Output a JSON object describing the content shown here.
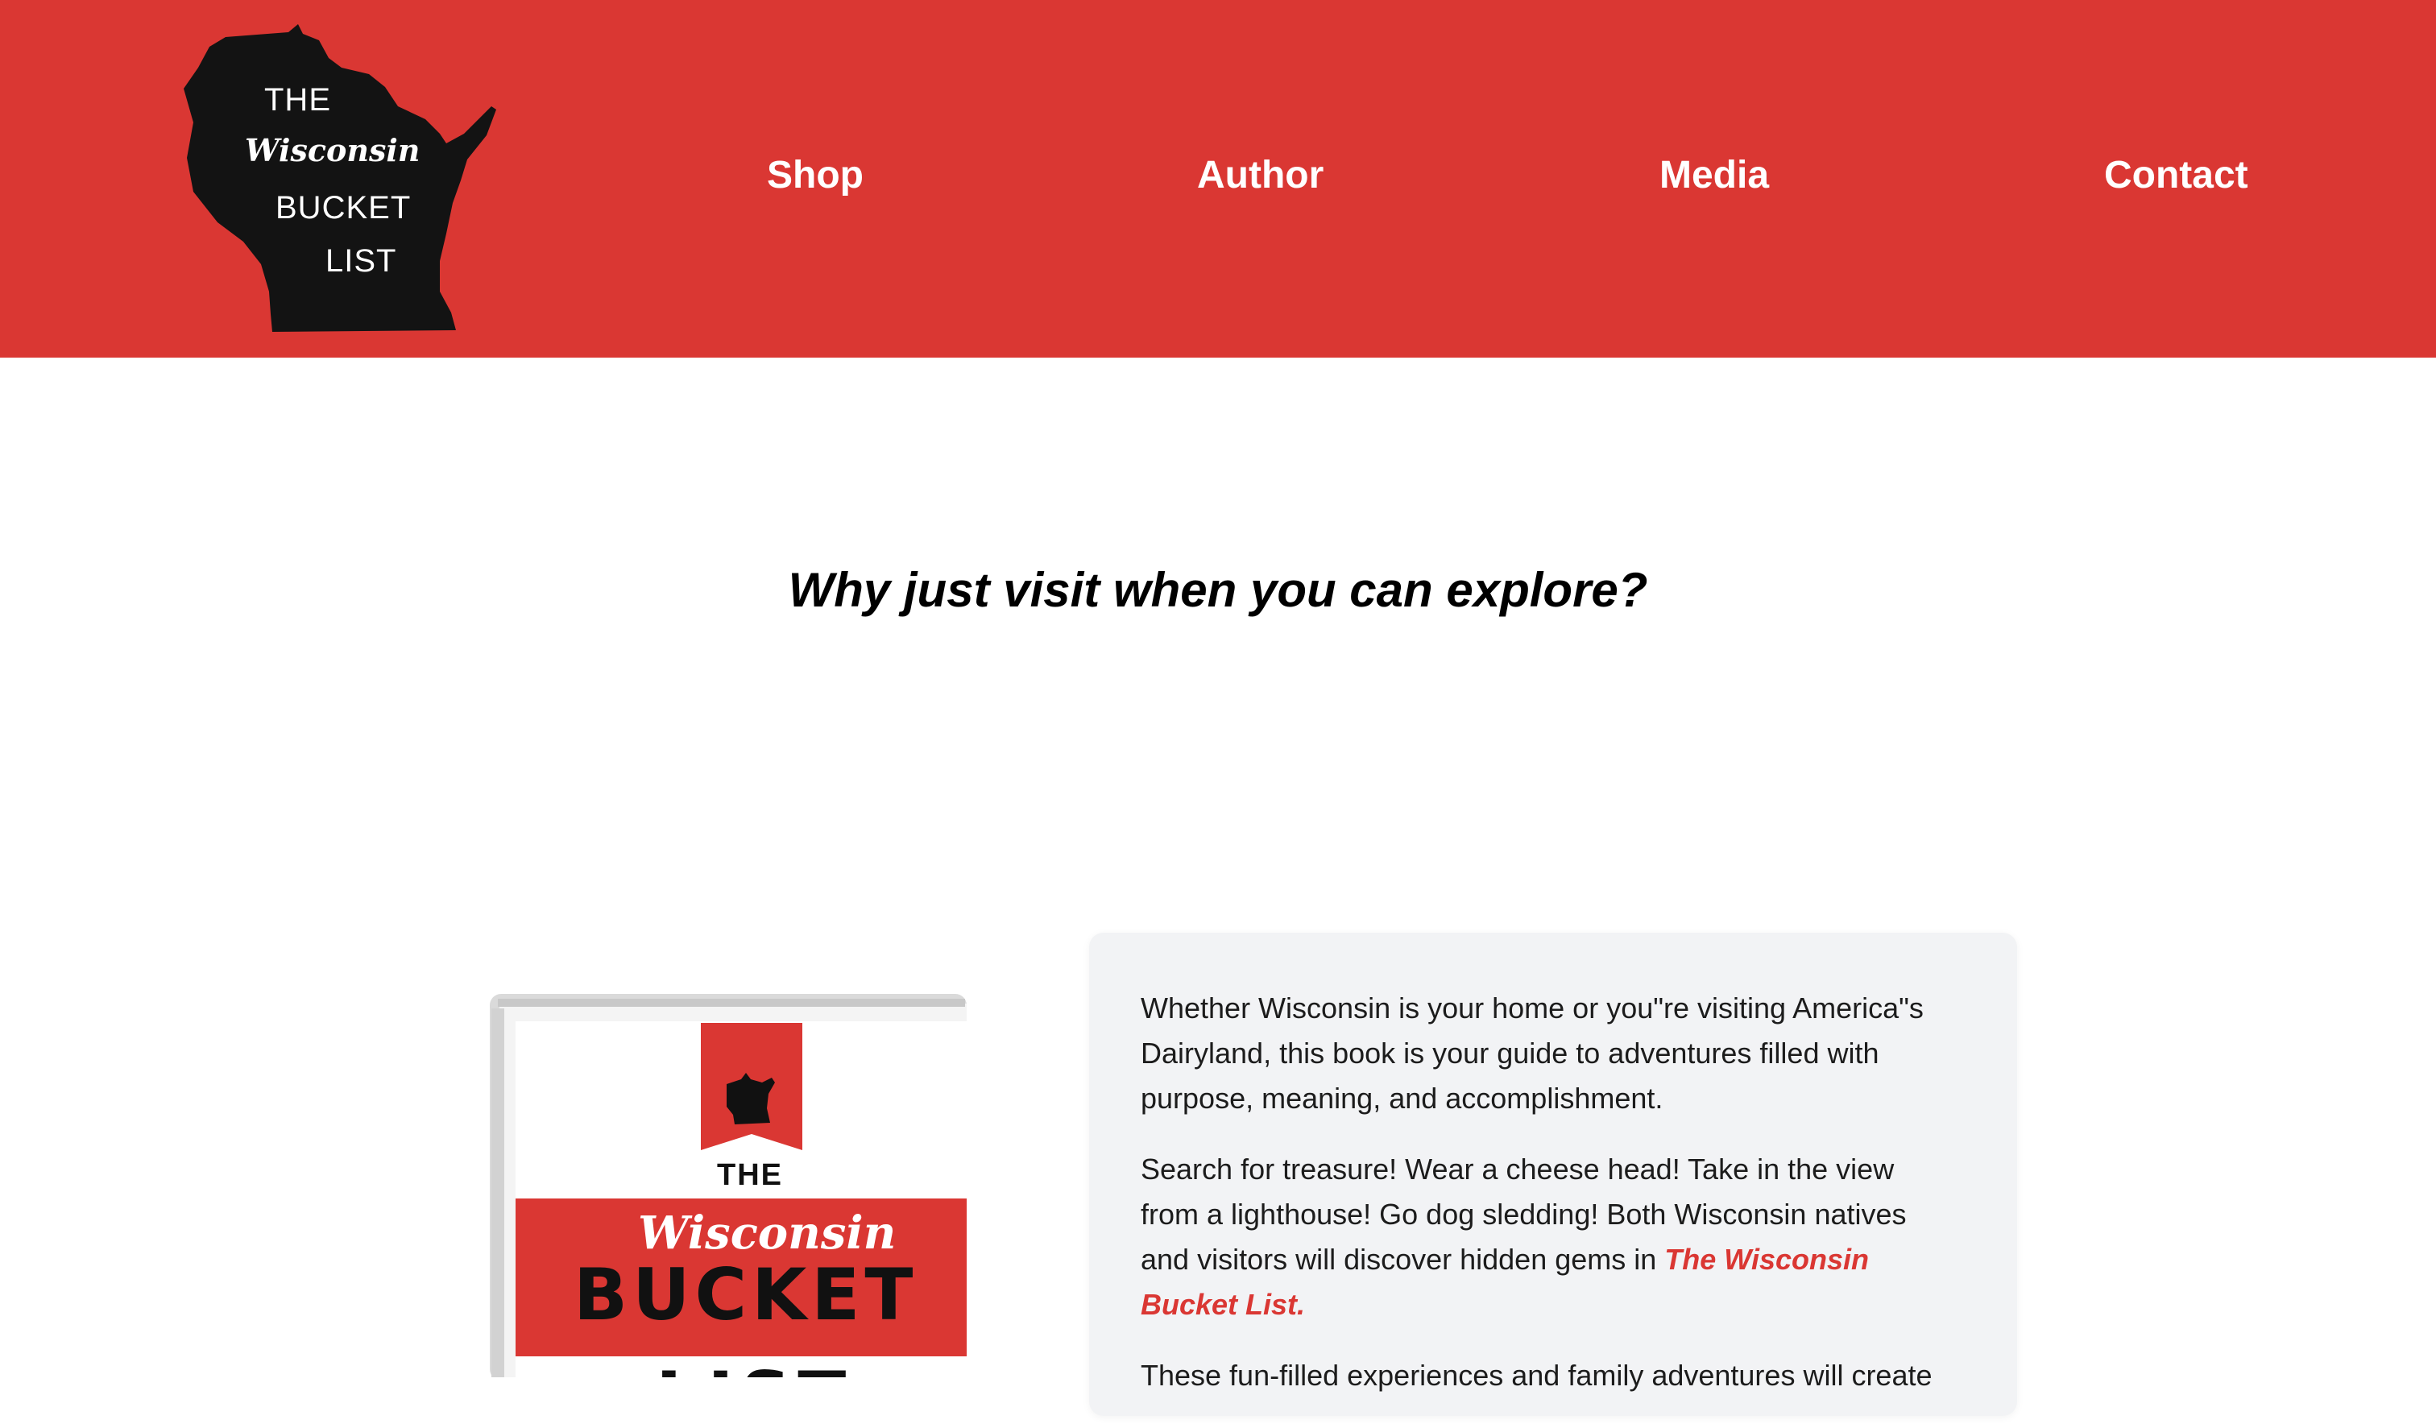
{
  "brand": {
    "logo_lines": [
      "THE",
      "Wisconsin",
      "BUCKET",
      "LIST"
    ],
    "colors": {
      "header_bg": "#da3733",
      "logo_fill": "#131313",
      "text_white": "#ffffff",
      "accent": "#da3733",
      "card_bg": "#f2f3f5"
    }
  },
  "nav": {
    "items": [
      {
        "label": "Shop"
      },
      {
        "label": "Author"
      },
      {
        "label": "Media"
      },
      {
        "label": "Contact"
      }
    ]
  },
  "hero": {
    "tagline": "Why just visit when you can explore?"
  },
  "book_cover": {
    "lines": [
      "THE",
      "Wisconsin",
      "BUCKET",
      "LIST"
    ]
  },
  "description": {
    "p1": "Whether Wisconsin is your home or you\"re visiting America\"s Dairyland, this book is your guide to adventures filled with purpose, meaning, and accomplishment.",
    "p2_before": "Search for treasure! Wear a cheese head! Take in the view from a lighthouse! Go dog sledding! Both Wisconsin natives and visitors will discover hidden gems in ",
    "p2_link": "The Wisconsin Bucket List.",
    "p3": "These fun-filled experiences and family adventures will create"
  }
}
